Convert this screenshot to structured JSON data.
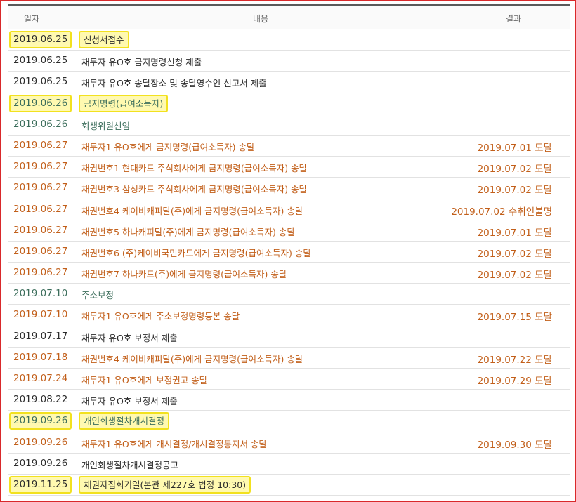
{
  "headers": {
    "date": "일자",
    "content": "내용",
    "result": "결과"
  },
  "rows": [
    {
      "date": "2019.06.25",
      "content": "신청서접수",
      "result": "",
      "color": "black",
      "highlight": true
    },
    {
      "date": "2019.06.25",
      "content": "채무자 유O호 금지명령신청 제출",
      "result": "",
      "color": "black",
      "highlight": false
    },
    {
      "date": "2019.06.25",
      "content": "채무자 유O호 송달장소 및 송달영수인 신고서 제출",
      "result": "",
      "color": "black",
      "highlight": false
    },
    {
      "date": "2019.06.26",
      "content": "금지명령(급여소득자)",
      "result": "",
      "color": "green",
      "highlight": true
    },
    {
      "date": "2019.06.26",
      "content": "회생위원선임",
      "result": "",
      "color": "green",
      "highlight": false
    },
    {
      "date": "2019.06.27",
      "content": "채무자1 유O호에게 금지명령(급여소득자) 송달",
      "result": "2019.07.01 도달",
      "color": "orange",
      "highlight": false
    },
    {
      "date": "2019.06.27",
      "content": "채권번호1 현대카드 주식회사에게 금지명령(급여소득자) 송달",
      "result": "2019.07.02 도달",
      "color": "orange",
      "highlight": false
    },
    {
      "date": "2019.06.27",
      "content": "채권번호3 삼성카드 주식회사에게 금지명령(급여소득자) 송달",
      "result": "2019.07.02 도달",
      "color": "orange",
      "highlight": false
    },
    {
      "date": "2019.06.27",
      "content": "채권번호4 케이비캐피탈(주)에게 금지명령(급여소득자) 송달",
      "result": "2019.07.02 수취인불명",
      "color": "orange",
      "highlight": false
    },
    {
      "date": "2019.06.27",
      "content": "채권번호5 하나캐피탈(주)에게 금지명령(급여소득자) 송달",
      "result": "2019.07.01 도달",
      "color": "orange",
      "highlight": false
    },
    {
      "date": "2019.06.27",
      "content": "채권번호6 (주)케이비국민카드에게 금지명령(급여소득자) 송달",
      "result": "2019.07.02 도달",
      "color": "orange",
      "highlight": false
    },
    {
      "date": "2019.06.27",
      "content": "채권번호7 하나카드(주)에게 금지명령(급여소득자) 송달",
      "result": "2019.07.02 도달",
      "color": "orange",
      "highlight": false
    },
    {
      "date": "2019.07.10",
      "content": "주소보정",
      "result": "",
      "color": "green",
      "highlight": false
    },
    {
      "date": "2019.07.10",
      "content": "채무자1 유O호에게 주소보정명령등본 송달",
      "result": "2019.07.15 도달",
      "color": "orange",
      "highlight": false
    },
    {
      "date": "2019.07.17",
      "content": "채무자 유O호 보정서 제출",
      "result": "",
      "color": "black",
      "highlight": false
    },
    {
      "date": "2019.07.18",
      "content": "채권번호4 케이비캐피탈(주)에게 금지명령(급여소득자) 송달",
      "result": "2019.07.22 도달",
      "color": "orange",
      "highlight": false
    },
    {
      "date": "2019.07.24",
      "content": "채무자1 유O호에게 보정권고 송달",
      "result": "2019.07.29 도달",
      "color": "orange",
      "highlight": false
    },
    {
      "date": "2019.08.22",
      "content": "채무자 유O호 보정서 제출",
      "result": "",
      "color": "black",
      "highlight": false
    },
    {
      "date": "2019.09.26",
      "content": "개인회생절차개시결정",
      "result": "",
      "color": "green",
      "highlight": true
    },
    {
      "date": "2019.09.26",
      "content": "채무자1 유O호에게 개시결정/개시결정통지서 송달",
      "result": "2019.09.30 도달",
      "color": "orange",
      "highlight": false
    },
    {
      "date": "2019.09.26",
      "content": "개인회생절차개시결정공고",
      "result": "",
      "color": "black",
      "highlight": false
    },
    {
      "date": "2019.11.25",
      "content": "채권자집회기일(본관 제227호 법정 10:30)",
      "result": "",
      "color": "black",
      "highlight": true
    }
  ],
  "colors": {
    "black": "#2b2b2b",
    "orange": "#c25f1a",
    "green": "#3b6d5b",
    "highlight_fill": "#fff9b0",
    "highlight_border": "#f2e11f",
    "frame": "#d9292b"
  }
}
